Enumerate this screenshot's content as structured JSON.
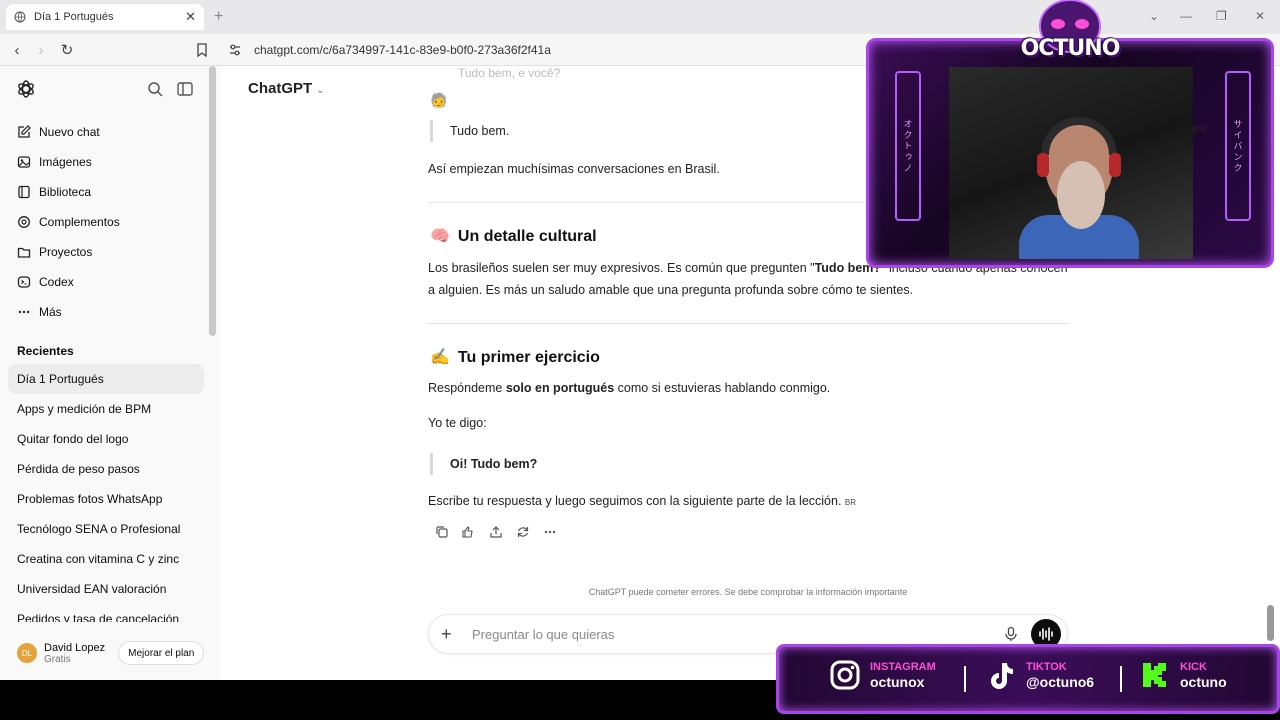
{
  "browser": {
    "tab_title": "Día 1 Portugués",
    "url": "chatgpt.com/c/6a734997-141c-83e9-b0f0-273a36f2f41a"
  },
  "sidebar": {
    "menu": [
      {
        "label": "Nuevo chat",
        "icon": "new-chat-icon"
      },
      {
        "label": "Imágenes",
        "icon": "images-icon"
      },
      {
        "label": "Biblioteca",
        "icon": "library-icon"
      },
      {
        "label": "Complementos",
        "icon": "plugins-icon"
      },
      {
        "label": "Proyectos",
        "icon": "folder-icon"
      },
      {
        "label": "Codex",
        "icon": "codex-icon"
      },
      {
        "label": "Más",
        "icon": "more-icon"
      }
    ],
    "recents_title": "Recientes",
    "recents": [
      "Día 1 Portugués",
      "Apps y medición de BPM",
      "Quitar fondo del logo",
      "Pérdida de peso pasos",
      "Problemas fotos WhatsApp",
      "Tecnólogo SENA o Profesional",
      "Creatina con vitamina C y zinc",
      "Universidad EAN valoración",
      "Pedidos y tasa de cancelación"
    ],
    "user": {
      "initials": "DL",
      "name": "David Lopez",
      "plan": "Gratis",
      "upgrade_label": "Mejorar el plan"
    }
  },
  "main": {
    "model_label": "ChatGPT",
    "faded_top": "Tudo bem, e você?",
    "emoji_line": "🧓",
    "quote1": "Tudo bem.",
    "para1": "Así empiezan muchísimas conversaciones en Brasil.",
    "h_cultural": {
      "emoji": "🧠",
      "text": "Un detalle cultural"
    },
    "para2_a": "Los brasileños suelen ser muy expresivos. Es común que pregunten \"",
    "para2_bold": "Tudo bem?",
    "para2_b": "\" incluso cuando apenas conocen a alguien. Es más un saludo amable que una pregunta profunda sobre cómo te sientes.",
    "h_exercise": {
      "emoji": "✍️",
      "text": "Tu primer ejercicio"
    },
    "para3_a": "Respóndeme ",
    "para3_bold": "solo en portugués",
    "para3_b": " como si estuvieras hablando conmigo.",
    "para4": "Yo te digo:",
    "quote2": "Oi! Tudo bem?",
    "para5": "Escribe tu respuesta y luego seguimos con la siguiente parte de la lección.",
    "para5_tag": "BR",
    "disclaimer": "ChatGPT puede cometer errores. Se debe comprobar la información importante",
    "composer_placeholder": "Preguntar lo que quieras"
  },
  "overlay": {
    "brand": "OCTUNO",
    "cam_partial_text": "artir",
    "cam_left_text": "オクトゥノ",
    "cam_right_text": "サイバンク",
    "socials": [
      {
        "platform": "INSTAGRAM",
        "handle": "octunox",
        "color": "#ff4fd8"
      },
      {
        "platform": "TIKTOK",
        "handle": "@octuno6",
        "color": "#ff4fd8"
      },
      {
        "platform": "KICK",
        "handle": "octuno",
        "color": "#ff4fd8"
      }
    ]
  }
}
